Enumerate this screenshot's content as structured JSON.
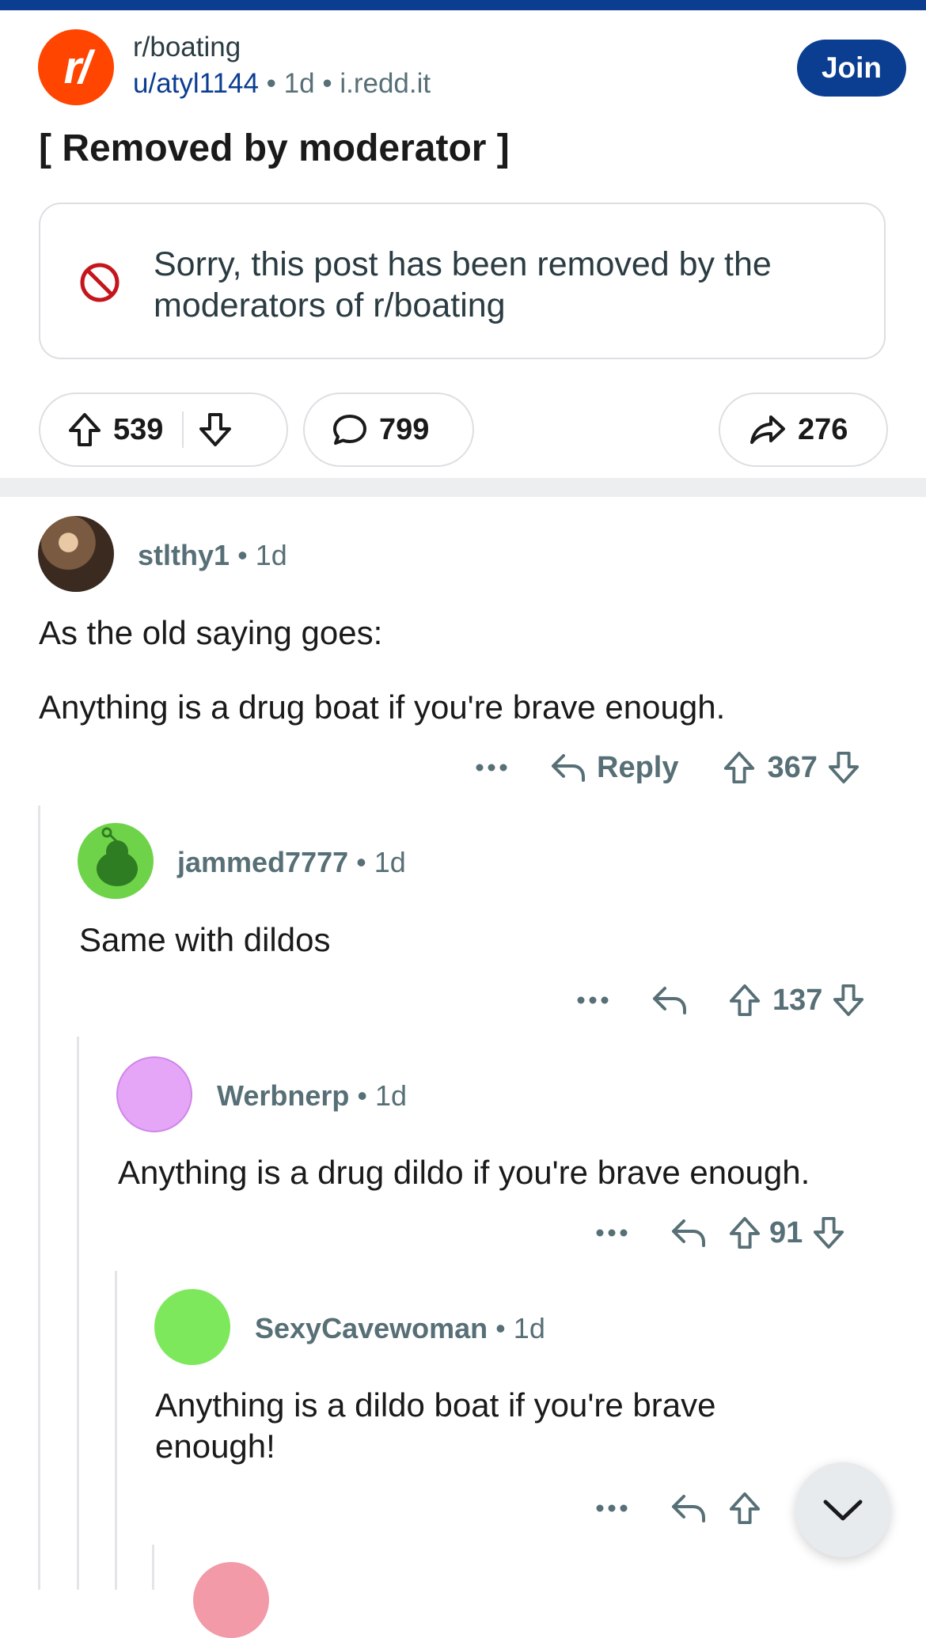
{
  "post": {
    "subreddit": "r/boating",
    "subreddit_icon_text": "r/",
    "author": "u/atyl1144",
    "age": "1d",
    "domain": "i.redd.it",
    "dot": "•",
    "join_label": "Join",
    "title": "[ Removed by moderator ]",
    "removed_message": "Sorry, this post has been removed by the moderators of r/boating",
    "upvotes": "539",
    "comments": "799",
    "shares": "276"
  },
  "comments": [
    {
      "author": "stlthy1",
      "age": "1d",
      "body": [
        "As the old saying goes:",
        "Anything is a drug boat if you're brave enough."
      ],
      "reply_label": "Reply",
      "score": "367",
      "avatar_color": "#6b4f3a"
    },
    {
      "author": "jammed7777",
      "age": "1d",
      "body": [
        "Same with dildos"
      ],
      "score": "137",
      "avatar_color": "#6fd34a"
    },
    {
      "author": "Werbnerp",
      "age": "1d",
      "body": [
        "Anything is a drug dildo if you're brave enough."
      ],
      "score": "91",
      "avatar_color": "#e6a6f8"
    },
    {
      "author": "SexyCavewoman",
      "age": "1d",
      "body": [
        "Anything is a dildo boat if you're brave enough!"
      ],
      "score": "",
      "avatar_color": "#7ee85c"
    }
  ],
  "icons": {
    "more": "more-options-icon",
    "reply": "reply-arrow-icon",
    "upvote": "upvote-arrow-icon",
    "downvote": "downvote-arrow-icon",
    "share": "share-arrow-icon",
    "comment": "comment-bubble-icon",
    "removed": "prohibited-icon",
    "scroll": "chevron-down-icon"
  },
  "colors": {
    "brand": "#0b3d91",
    "subreddit": "#ff4500",
    "removed": "#c4161c"
  }
}
